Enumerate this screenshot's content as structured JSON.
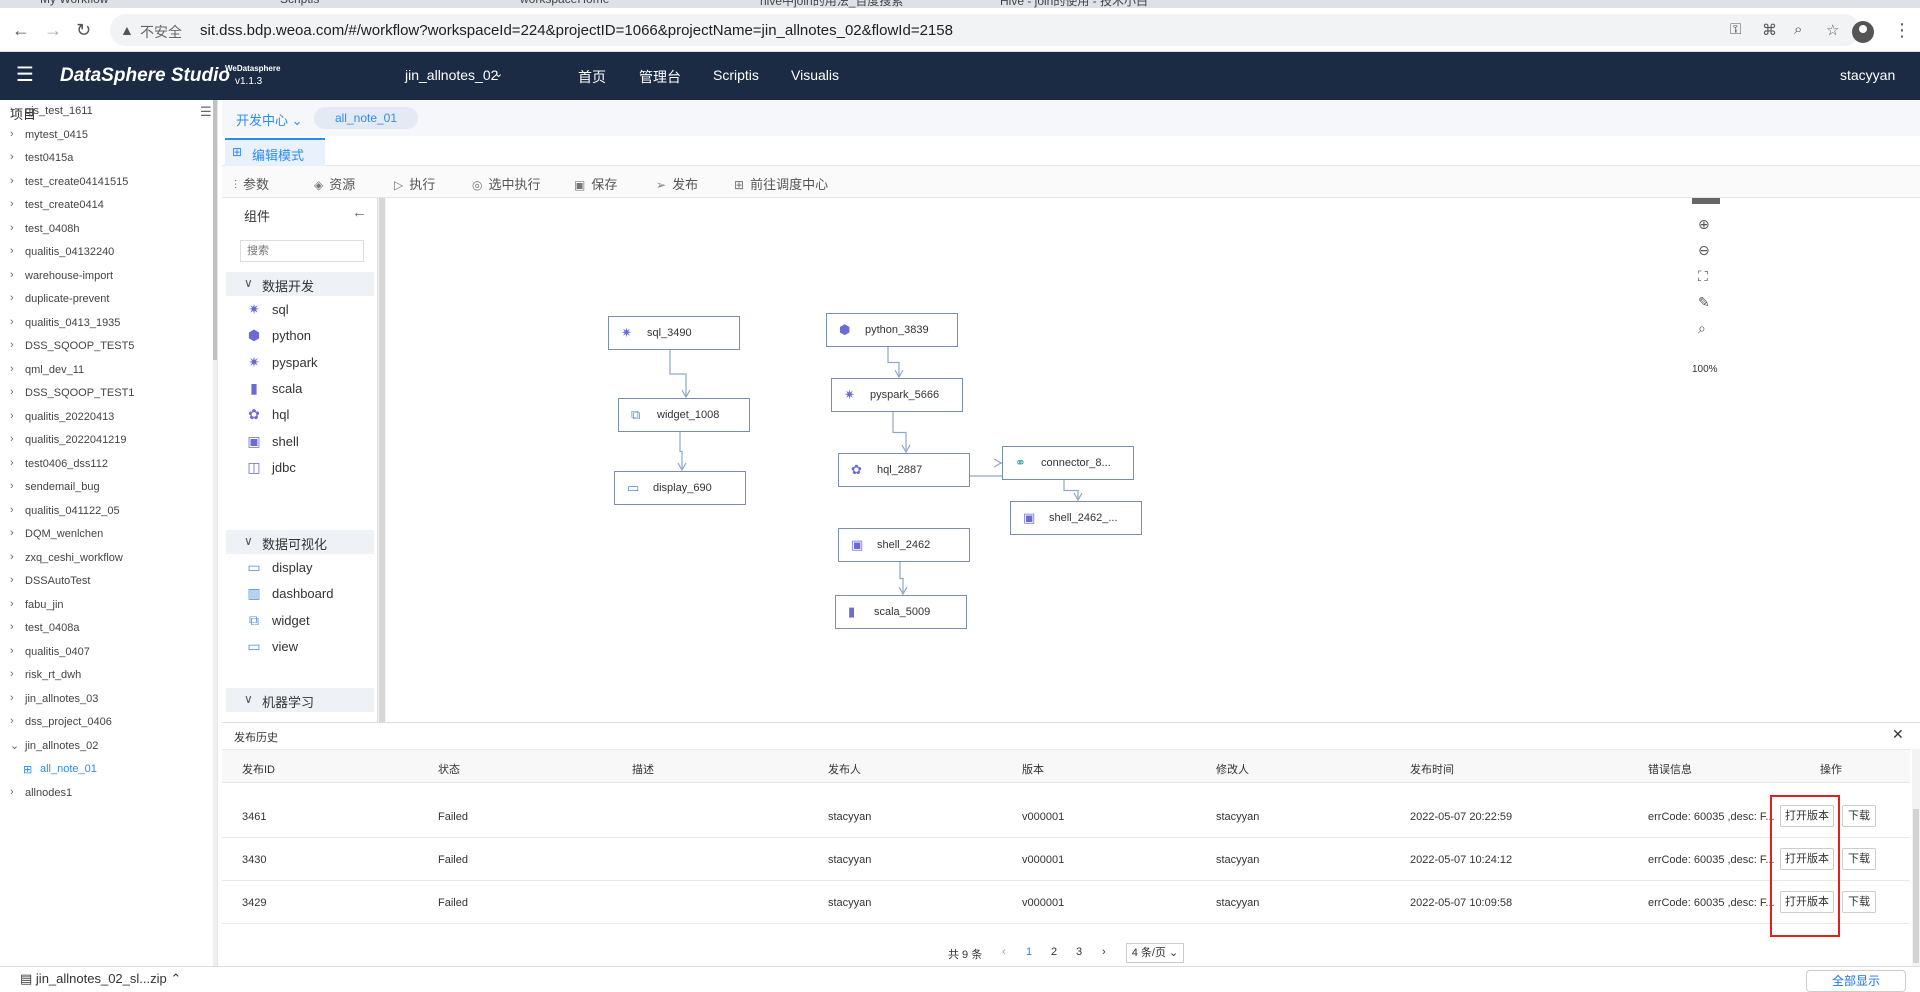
{
  "browser": {
    "tabs": [
      "My Workflow",
      "Scriptis",
      "workspaceHome",
      "hive中join的用法_百度搜索",
      "Hive - join的使用 - 技术小白"
    ],
    "insecure_label": "不安全",
    "url": "sit.dss.bdp.weoa.com/#/workflow?workspaceId=224&projectID=1066&projectName=jin_allnotes_02&flowId=2158"
  },
  "header": {
    "brand": "DataSphere Studio",
    "brand_sup": "WeDatasphere",
    "version": "v1.1.3",
    "workspace": "jin_allnotes_02",
    "nav": [
      "首页",
      "管理台",
      "Scriptis",
      "Visualis"
    ],
    "user": "stacyyan"
  },
  "tree": {
    "title": "项目",
    "items": [
      "qjs_test_1611",
      "mytest_0415",
      "test0415a",
      "test_create04141515",
      "test_create0414",
      "test_0408h",
      "qualitis_04132240",
      "warehouse-import",
      "duplicate-prevent",
      "qualitis_0413_1935",
      "DSS_SQOOP_TEST5",
      "qml_dev_11",
      "DSS_SQOOP_TEST1",
      "qualitis_20220413",
      "qualitis_2022041219",
      "test0406_dss112",
      "sendemail_bug",
      "qualitis_041122_05",
      "DQM_wenlchen",
      "zxq_ceshi_workflow",
      "DSSAutoTest",
      "fabu_jin",
      "test_0408a",
      "qualitis_0407",
      "risk_rt_dwh",
      "jin_allnotes_03",
      "dss_project_0406",
      "jin_allnotes_02"
    ],
    "expanded_child": "all_note_01",
    "last_item": "allnodes1"
  },
  "crumb": {
    "dev_center": "开发中心",
    "flow_tab": "all_note_01"
  },
  "mode_tab": "编辑模式",
  "toolbar": {
    "items": [
      "参数",
      "资源",
      "执行",
      "选中执行",
      "保存",
      "发布",
      "前往调度中心"
    ]
  },
  "components": {
    "title": "组件",
    "search_placeholder": "搜索",
    "group1": "数据开发",
    "group1_items": [
      "sql",
      "python",
      "pyspark",
      "scala",
      "hql",
      "shell",
      "jdbc"
    ],
    "group2": "数据可视化",
    "group2_items": [
      "display",
      "dashboard",
      "widget",
      "view"
    ],
    "group3": "机器学习"
  },
  "canvas": {
    "nodes": [
      "sql_3490",
      "widget_1008",
      "display_690",
      "python_3839",
      "pyspark_5666",
      "hql_2887",
      "connector_8...",
      "shell_2462_...",
      "shell_2462",
      "scala_5009"
    ],
    "zoom": "100%"
  },
  "history": {
    "title": "发布历史",
    "columns": [
      "发布ID",
      "状态",
      "描述",
      "发布人",
      "版本",
      "修改人",
      "发布时间",
      "错误信息",
      "操作"
    ],
    "rows": [
      {
        "id": "3461",
        "status": "Failed",
        "publisher": "stacyyan",
        "version": "v000001",
        "modifier": "stacyyan",
        "time": "2022-05-07 20:22:59",
        "error": "errCode: 60035 ,desc: F..."
      },
      {
        "id": "3430",
        "status": "Failed",
        "publisher": "stacyyan",
        "version": "v000001",
        "modifier": "stacyyan",
        "time": "2022-05-07 10:24:12",
        "error": "errCode: 60035 ,desc: F..."
      },
      {
        "id": "3429",
        "status": "Failed",
        "publisher": "stacyyan",
        "version": "v000001",
        "modifier": "stacyyan",
        "time": "2022-05-07 10:09:58",
        "error": "errCode: 60035 ,desc: F..."
      }
    ],
    "open_label": "打开版本",
    "download_label": "下载",
    "pager": {
      "total": "共 9 条",
      "pages": [
        "1",
        "2",
        "3"
      ],
      "page_size": "4 条/页"
    }
  },
  "downloads": {
    "file": "jin_allnotes_02_sl...zip",
    "show_all": "全部显示"
  },
  "colors": {
    "header_bg": "#1b2b44",
    "accent": "#2d8cf0",
    "highlight": "#e02020"
  }
}
